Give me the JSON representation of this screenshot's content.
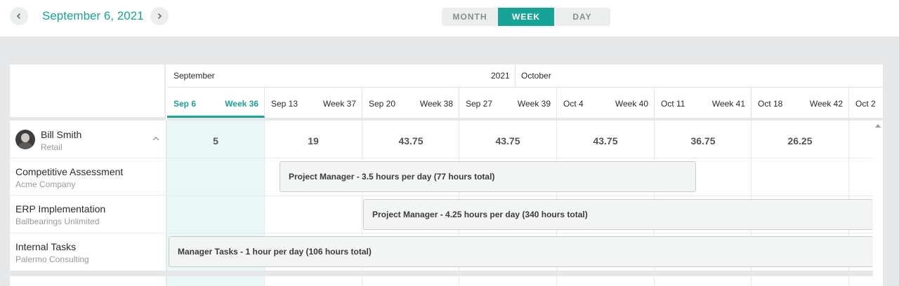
{
  "header": {
    "date": "September 6, 2021",
    "views": [
      {
        "label": "MONTH",
        "active": false
      },
      {
        "label": "WEEK",
        "active": true
      },
      {
        "label": "DAY",
        "active": false
      }
    ]
  },
  "timeline": {
    "months": {
      "left": "September",
      "year": "2021",
      "right": "October"
    },
    "weeks": [
      {
        "date": "Sep 6",
        "week": "Week 36",
        "current": true
      },
      {
        "date": "Sep 13",
        "week": "Week 37"
      },
      {
        "date": "Sep 20",
        "week": "Week 38"
      },
      {
        "date": "Sep 27",
        "week": "Week 39"
      },
      {
        "date": "Oct 4",
        "week": "Week 40"
      },
      {
        "date": "Oct 11",
        "week": "Week 41"
      },
      {
        "date": "Oct 18",
        "week": "Week 42"
      },
      {
        "date": "Oct 2"
      }
    ]
  },
  "person": {
    "name": "Bill Smith",
    "team": "Retail",
    "totals": [
      "5",
      "19",
      "43.75",
      "43.75",
      "43.75",
      "36.75",
      "26.25"
    ]
  },
  "rows": [
    {
      "project": "Competitive Assessment",
      "client": "Acme Company"
    },
    {
      "project": "ERP Implementation",
      "client": "Ballbearings Unlimited"
    },
    {
      "project": "Internal Tasks",
      "client": "Palermo Consulting"
    }
  ],
  "bars": [
    {
      "label": "Project Manager - 3.5 hours per day (77 hours total)"
    },
    {
      "label": "Project Manager - 4.25 hours per day (340 hours total)"
    },
    {
      "label": "Manager Tasks - 1 hour per day (106 hours total)"
    }
  ],
  "colors": {
    "accent": "#17a397",
    "current_week_bg": "#e9f7f6",
    "background": "#e6e7e9"
  },
  "icons": [
    "chevron-left-icon",
    "chevron-right-icon",
    "chevron-up-icon",
    "avatar"
  ]
}
